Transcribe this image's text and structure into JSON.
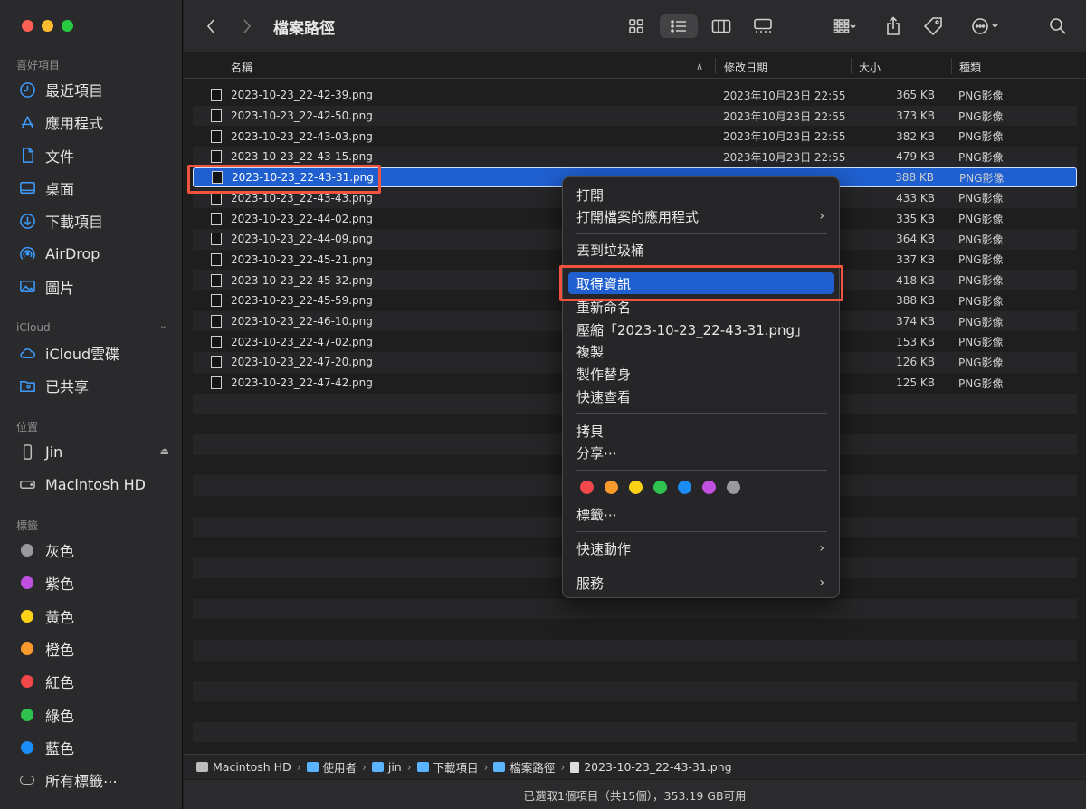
{
  "toolbar": {
    "title": "檔案路徑",
    "back_icon": "chevron-left-icon",
    "forward_icon": "chevron-right-icon"
  },
  "sidebar": {
    "favorites_label": "喜好項目",
    "favorites": [
      {
        "label": "最近項目",
        "icon": "clock-icon"
      },
      {
        "label": "應用程式",
        "icon": "apps-icon"
      },
      {
        "label": "文件",
        "icon": "document-icon"
      },
      {
        "label": "桌面",
        "icon": "desktop-icon"
      },
      {
        "label": "下載項目",
        "icon": "download-icon"
      },
      {
        "label": "AirDrop",
        "icon": "airdrop-icon"
      },
      {
        "label": "圖片",
        "icon": "photo-icon"
      }
    ],
    "icloud_label": "iCloud",
    "icloud": [
      {
        "label": "iCloud雲碟",
        "icon": "cloud-icon"
      },
      {
        "label": "已共享",
        "icon": "shared-folder-icon"
      }
    ],
    "locations_label": "位置",
    "locations": [
      {
        "label": "Jin",
        "icon": "phone-icon"
      },
      {
        "label": "Macintosh HD",
        "icon": "disk-icon"
      }
    ],
    "tags_label": "標籤",
    "tags": [
      {
        "label": "灰色",
        "color": "#9a9a9e"
      },
      {
        "label": "紫色",
        "color": "#c050e0"
      },
      {
        "label": "黃色",
        "color": "#fcd116"
      },
      {
        "label": "橙色",
        "color": "#fb9a2c"
      },
      {
        "label": "紅色",
        "color": "#f2474b"
      },
      {
        "label": "綠色",
        "color": "#2fc24e"
      },
      {
        "label": "藍色",
        "color": "#1b8cf6"
      }
    ],
    "all_tags_label": "所有標籤⋯"
  },
  "columns": {
    "name": "名稱",
    "date": "修改日期",
    "size": "大小",
    "kind": "種類"
  },
  "files": [
    {
      "name": "2023-10-23_22-42-39.png",
      "date": "2023年10月23日 22:55",
      "size": "365 KB",
      "kind": "PNG影像"
    },
    {
      "name": "2023-10-23_22-42-50.png",
      "date": "2023年10月23日 22:55",
      "size": "373 KB",
      "kind": "PNG影像"
    },
    {
      "name": "2023-10-23_22-43-03.png",
      "date": "2023年10月23日 22:55",
      "size": "382 KB",
      "kind": "PNG影像"
    },
    {
      "name": "2023-10-23_22-43-15.png",
      "date": "2023年10月23日 22:55",
      "size": "479 KB",
      "kind": "PNG影像"
    },
    {
      "name": "2023-10-23_22-43-31.png",
      "date": "",
      "size": "388 KB",
      "kind": "PNG影像"
    },
    {
      "name": "2023-10-23_22-43-43.png",
      "date": "",
      "size": "433 KB",
      "kind": "PNG影像"
    },
    {
      "name": "2023-10-23_22-44-02.png",
      "date": "",
      "size": "335 KB",
      "kind": "PNG影像"
    },
    {
      "name": "2023-10-23_22-44-09.png",
      "date": "",
      "size": "364 KB",
      "kind": "PNG影像"
    },
    {
      "name": "2023-10-23_22-45-21.png",
      "date": "",
      "size": "337 KB",
      "kind": "PNG影像"
    },
    {
      "name": "2023-10-23_22-45-32.png",
      "date": "",
      "size": "418 KB",
      "kind": "PNG影像"
    },
    {
      "name": "2023-10-23_22-45-59.png",
      "date": "",
      "size": "388 KB",
      "kind": "PNG影像"
    },
    {
      "name": "2023-10-23_22-46-10.png",
      "date": "",
      "size": "374 KB",
      "kind": "PNG影像"
    },
    {
      "name": "2023-10-23_22-47-02.png",
      "date": "",
      "size": "153 KB",
      "kind": "PNG影像"
    },
    {
      "name": "2023-10-23_22-47-20.png",
      "date": "",
      "size": "126 KB",
      "kind": "PNG影像"
    },
    {
      "name": "2023-10-23_22-47-42.png",
      "date": "",
      "size": "125 KB",
      "kind": "PNG影像"
    }
  ],
  "menu": {
    "open": "打開",
    "open_with": "打開檔案的應用程式",
    "trash": "丟到垃圾桶",
    "get_info": "取得資訊",
    "rename": "重新命名",
    "compress": "壓縮「2023-10-23_22-43-31.png」",
    "duplicate": "複製",
    "make_alias": "製作替身",
    "quick_look": "快速查看",
    "copy": "拷貝",
    "share": "分享⋯",
    "tag_colors": [
      "#f2474b",
      "#fb9a2c",
      "#fcd116",
      "#2fc24e",
      "#1b8cf6",
      "#c050e0",
      "#9a9a9e"
    ],
    "tags": "標籤⋯",
    "quick_actions": "快速動作",
    "services": "服務"
  },
  "pathbar": [
    "Macintosh HD",
    "使用者",
    "jin",
    "下載項目",
    "檔案路徑",
    "2023-10-23_22-43-31.png"
  ],
  "status": "已選取1個項目（共15個），353.19 GB可用"
}
